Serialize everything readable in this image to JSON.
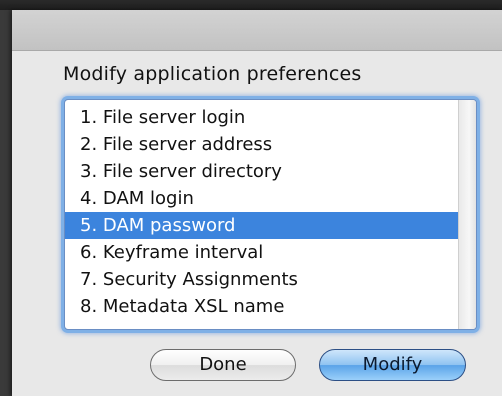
{
  "prompt": "Modify application preferences",
  "list": {
    "items": [
      "1. File server login",
      "2. File server address",
      "3. File server directory",
      "4. DAM login",
      "5. DAM password",
      "6. Keyframe interval",
      "7. Security Assignments",
      "8. Metadata XSL name"
    ],
    "selected_index": 4
  },
  "buttons": {
    "done_label": "Done",
    "modify_label": "Modify"
  },
  "colors": {
    "selection": "#3c84dd",
    "default_button": "#5aa3e8"
  }
}
